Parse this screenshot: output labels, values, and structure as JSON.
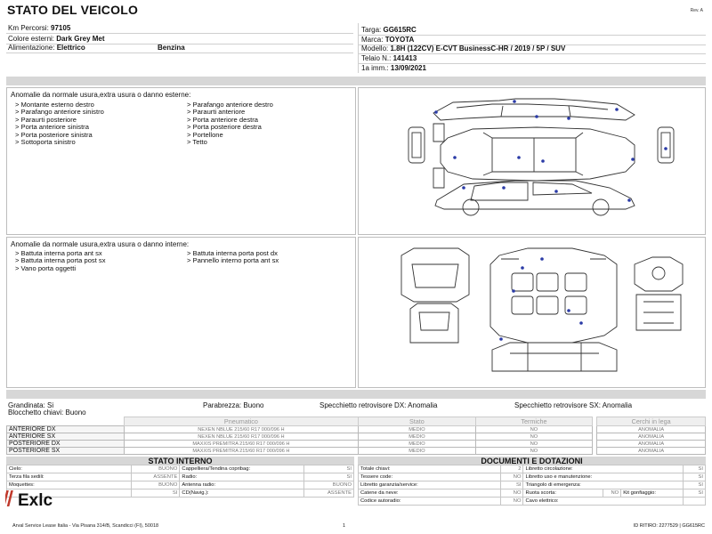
{
  "header": {
    "title": "STATO DEL VEICOLO",
    "rev": "Rev. A"
  },
  "vehicle_left": [
    {
      "label": "Km Percorsi:",
      "value": "97105"
    },
    {
      "label": "Colore esterni:",
      "value": "Dark Grey Met"
    },
    {
      "label": "Alimentazione:",
      "value": "Elettrico",
      "extra": "Benzina"
    }
  ],
  "vehicle_right": [
    {
      "label": "Targa:",
      "value": "GG615RC"
    },
    {
      "label": "Marca:",
      "value": "TOYOTA"
    },
    {
      "label": "Modello:",
      "value": "1.8H (122CV) E-CVT BusinessC-HR / 2019 / 5P / SUV"
    },
    {
      "label": "Telaio N.:",
      "value": "141413"
    },
    {
      "label": "1a imm.:",
      "value": "13/09/2021"
    }
  ],
  "external": {
    "title": "Anomalie da normale usura,extra usura o danno esterne:",
    "col1": [
      "> Montante esterno destro",
      "> Parafango anteriore sinistro",
      "> Paraurti posteriore",
      "> Porta anteriore sinistra",
      "> Porta posteriore sinistra",
      "> Sottoporta sinistro"
    ],
    "col2": [
      "> Parafango anteriore destro",
      "> Paraurti anteriore",
      "> Porta anteriore destra",
      "> Porta posteriore destra",
      "> Portellone",
      "> Tetto"
    ]
  },
  "internal": {
    "title": "Anomalie da normale usura,extra usura o danno interne:",
    "col1": [
      "> Battuta interna porta ant sx",
      "> Battuta interna porta post sx",
      "> Vano porta oggetti"
    ],
    "col2": [
      "> Battuta interna porta post dx",
      "> Pannello interno porta ant sx"
    ]
  },
  "status": {
    "grandinata": "Grandinata: Si",
    "parabrezza": "Parabrezza: Buono",
    "specchietto_dx": "Specchietto retrovisore DX: Anomalia",
    "specchietto_sx": "Specchietto retrovisore SX: Anomalia",
    "blocchetto": "Blocchetto chiavi: Buono"
  },
  "tyres": {
    "headers": [
      "Pneumatico",
      "Stato",
      "Termiche",
      "Cerchi in lega"
    ],
    "rows": [
      {
        "pos": "ANTERIORE DX",
        "tyre": "NEXEN NBLUE 215/60 R17 000/096 H",
        "stato": "MEDIO",
        "termiche": "NO",
        "cerchi": "ANOMALIA"
      },
      {
        "pos": "ANTERIORE SX",
        "tyre": "NEXEN NBLUE 215/60 R17 000/096 H",
        "stato": "MEDIO",
        "termiche": "NO",
        "cerchi": "ANOMALIA"
      },
      {
        "pos": "POSTERIORE DX",
        "tyre": "MAXXIS PREMITRA 215/60 R17 000/096 H",
        "stato": "MEDIO",
        "termiche": "NO",
        "cerchi": "ANOMALIA"
      },
      {
        "pos": "POSTERIORE SX",
        "tyre": "MAXXIS PREMITRA 215/60 R17 000/096 H",
        "stato": "MEDIO",
        "termiche": "NO",
        "cerchi": "ANOMALIA"
      }
    ]
  },
  "stato_interno": {
    "title": "STATO INTERNO",
    "rows": [
      [
        {
          "label": "Cielo:",
          "value": "BUONO"
        },
        {
          "label": "Cappelliera/Tendina copribag:",
          "value": "SI"
        }
      ],
      [
        {
          "label": "Terza fila sedili:",
          "value": "ASSENTE"
        },
        {
          "label": "Radio:",
          "value": "SI"
        }
      ],
      [
        {
          "label": "Moquettes:",
          "value": "BUONO"
        },
        {
          "label": "Antenna radio:",
          "value": "BUONO"
        }
      ],
      [
        {
          "label": "",
          "value": "SI"
        },
        {
          "label": "CD(Navig.):",
          "value": "ASSENTE"
        }
      ]
    ]
  },
  "documenti": {
    "title": "DOCUMENTI E DOTAZIONI",
    "rows": [
      [
        {
          "label": "Totale chiavi:",
          "value": "2"
        },
        {
          "label": "Libretto circolazione:",
          "value": "SI"
        }
      ],
      [
        {
          "label": "Tessere code:",
          "value": "NO"
        },
        {
          "label": "Libretto uso e manutenzione:",
          "value": "SI"
        }
      ],
      [
        {
          "label": "Libretto garanzia/service:",
          "value": "SI"
        },
        {
          "label": "Triangolo di emergenza:",
          "value": "SI"
        }
      ],
      [
        {
          "label": "Catene da neve:",
          "value": "NO"
        },
        {
          "label": "Ruota scorta:",
          "value": "NO",
          "label2": "Kit gonfiaggio:",
          "value2": "SI"
        }
      ],
      [
        {
          "label": "Codice autoradio:",
          "value": "NO"
        },
        {
          "label": "Cavo elettrico:",
          "value": ""
        }
      ]
    ]
  },
  "logo": {
    "text": "Exlc",
    "brand_color": "#c0392b"
  },
  "footer": {
    "left": "Arval Service Lease Italia - Via Pisana 314/B, Scandicci (FI), 50018",
    "page": "1",
    "right": "ID RITIRO: 2277529 | GG615RC"
  },
  "colors": {
    "accent_dot": "#2a3aa6",
    "band": "#d7d7d7"
  },
  "icons": [
    "car-exterior-diagram",
    "car-interior-diagram",
    "damage-marker"
  ]
}
